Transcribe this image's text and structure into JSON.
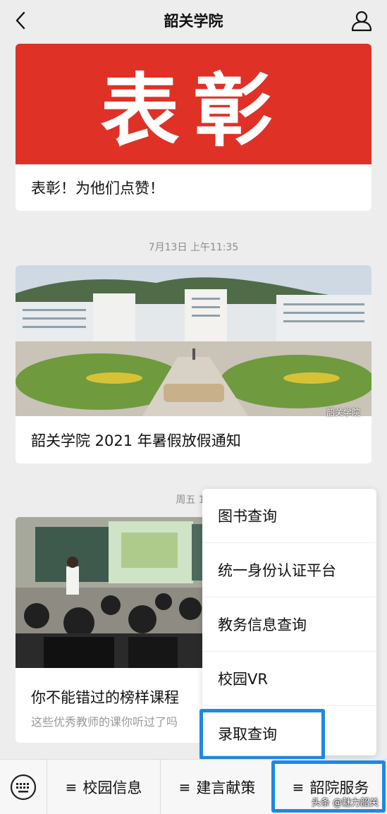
{
  "header": {
    "title": "韶关学院",
    "back_icon": "back-arrow-icon",
    "user_icon": "user-icon"
  },
  "cards": [
    {
      "banner_text": "表彰",
      "banner_color": "#e03127",
      "caption": "表彰！为他们点赞！"
    },
    {
      "timestamp": "7月13日 上午11:35",
      "caption": "韶关学院 2021 年暑假放假通知",
      "image_watermark": "韶关学院"
    },
    {
      "timestamp": "周五 19",
      "caption": "你不能错过的榜样课程",
      "subcaption": "这些优秀教师的课你听过了吗"
    }
  ],
  "menu": {
    "items": [
      "图书查询",
      "统一身份认证平台",
      "教务信息查询",
      "校园VR",
      "录取查询"
    ],
    "highlighted": "录取查询"
  },
  "tabbar": {
    "keyboard_icon": "keyboard-icon",
    "tabs": [
      "校园信息",
      "建言献策",
      "韶院服务"
    ],
    "highlighted": "韶院服务"
  },
  "watermark": "头条 @魅力韶关",
  "colors": {
    "highlight": "#1e88e5",
    "banner_red": "#e03127"
  }
}
